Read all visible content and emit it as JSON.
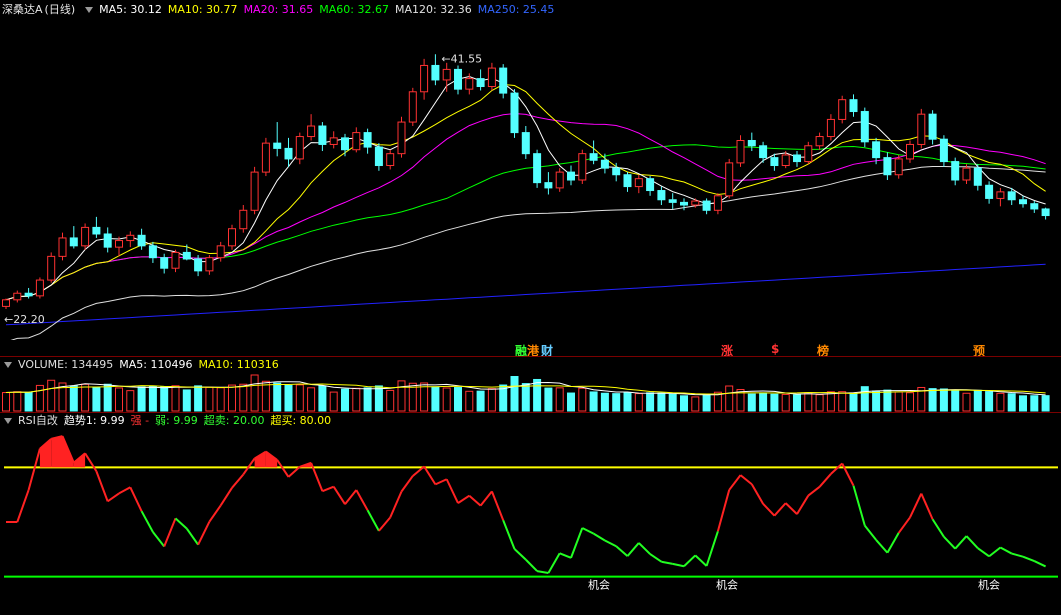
{
  "price_header": {
    "stock_name": "深桑达A",
    "period": "(日线)",
    "ma5": "MA5: 30.12",
    "ma10": "MA10: 30.77",
    "ma20": "MA20: 31.65",
    "ma60": "MA60: 32.67",
    "ma120": "MA120: 32.36",
    "ma250": "MA250: 25.45"
  },
  "price_labels": {
    "high": "41.55",
    "low": "22.20"
  },
  "events": [
    {
      "id": "e1",
      "text": "融",
      "color": "#33ff33"
    },
    {
      "id": "e2",
      "text": "港",
      "color": "#ff8800"
    },
    {
      "id": "e3",
      "text": "财",
      "color": "#66ccff"
    },
    {
      "id": "e4",
      "text": "涨",
      "color": "#ff3333"
    },
    {
      "id": "e5",
      "text": "$",
      "color": "#ff3333"
    },
    {
      "id": "e6",
      "text": "榜",
      "color": "#ff8800"
    },
    {
      "id": "e7",
      "text": "预",
      "color": "#ff8800"
    }
  ],
  "volume_header": {
    "name": "VOLUME: 134495",
    "ma5": "MA5: 110496",
    "ma10": "MA10: 110316"
  },
  "rsi_header": {
    "name": "RSI自改",
    "trend": "趋势1: 9.99",
    "strong": "强 -",
    "weak": "弱: 9.99",
    "oversold": "超卖: 20.00",
    "overbought": "超买: 80.00"
  },
  "rsi_labels": [
    "机会",
    "机会",
    "机会"
  ],
  "colors": {
    "up": "#ff3232",
    "down": "#54ffff",
    "ma5": "#ffffff",
    "ma10": "#ffff00",
    "ma20": "#ff00ff",
    "ma60": "#00ff00",
    "ma120": "#e0e0e0",
    "ma250": "#2222ff",
    "grid": "#7a0000"
  },
  "chart_data": {
    "type": "candlestick",
    "ylim": [
      20,
      44
    ],
    "candles": [
      [
        22.4,
        23.0,
        22.2,
        22.9
      ],
      [
        22.9,
        23.6,
        22.7,
        23.4
      ],
      [
        23.4,
        23.8,
        23.0,
        23.2
      ],
      [
        23.2,
        24.6,
        23.0,
        24.4
      ],
      [
        24.4,
        26.5,
        24.2,
        26.2
      ],
      [
        26.2,
        28.0,
        25.9,
        27.6
      ],
      [
        27.6,
        28.5,
        26.8,
        27.0
      ],
      [
        27.0,
        28.7,
        26.7,
        28.4
      ],
      [
        28.4,
        29.2,
        27.6,
        27.9
      ],
      [
        27.9,
        28.4,
        26.5,
        26.9
      ],
      [
        26.9,
        27.7,
        26.2,
        27.4
      ],
      [
        27.4,
        28.1,
        26.9,
        27.8
      ],
      [
        27.8,
        28.3,
        26.7,
        27.0
      ],
      [
        27.0,
        27.3,
        25.7,
        26.1
      ],
      [
        26.1,
        26.4,
        24.9,
        25.3
      ],
      [
        25.3,
        26.7,
        25.0,
        26.5
      ],
      [
        26.5,
        27.1,
        25.9,
        26.0
      ],
      [
        26.0,
        26.3,
        24.7,
        25.1
      ],
      [
        25.1,
        26.3,
        24.8,
        26.1
      ],
      [
        26.1,
        27.3,
        25.8,
        27.0
      ],
      [
        27.0,
        28.6,
        26.7,
        28.3
      ],
      [
        28.3,
        30.1,
        28.0,
        29.7
      ],
      [
        29.7,
        33.0,
        29.4,
        32.6
      ],
      [
        32.6,
        35.2,
        32.3,
        34.8
      ],
      [
        34.8,
        36.4,
        33.8,
        34.4
      ],
      [
        34.4,
        35.2,
        33.0,
        33.6
      ],
      [
        33.6,
        35.6,
        33.2,
        35.3
      ],
      [
        35.3,
        37.0,
        35.0,
        36.1
      ],
      [
        36.1,
        36.4,
        34.2,
        34.7
      ],
      [
        34.7,
        35.7,
        34.4,
        35.2
      ],
      [
        35.2,
        35.5,
        33.8,
        34.3
      ],
      [
        34.3,
        36.0,
        34.1,
        35.6
      ],
      [
        35.6,
        35.9,
        34.0,
        34.5
      ],
      [
        34.5,
        34.8,
        32.7,
        33.1
      ],
      [
        33.1,
        34.3,
        32.8,
        34.0
      ],
      [
        34.0,
        36.8,
        33.7,
        36.4
      ],
      [
        36.4,
        39.0,
        36.1,
        38.7
      ],
      [
        38.7,
        41.2,
        38.1,
        40.7
      ],
      [
        40.7,
        41.55,
        39.2,
        39.6
      ],
      [
        39.6,
        40.9,
        38.7,
        40.4
      ],
      [
        40.4,
        40.7,
        38.5,
        38.9
      ],
      [
        38.9,
        40.1,
        38.5,
        39.7
      ],
      [
        39.7,
        40.4,
        38.8,
        39.1
      ],
      [
        39.1,
        40.9,
        38.8,
        40.5
      ],
      [
        40.5,
        40.8,
        38.2,
        38.6
      ],
      [
        38.6,
        38.9,
        35.2,
        35.6
      ],
      [
        35.6,
        36.1,
        33.6,
        34.0
      ],
      [
        34.0,
        34.3,
        31.4,
        31.8
      ],
      [
        31.8,
        32.6,
        30.9,
        31.4
      ],
      [
        31.4,
        32.9,
        31.1,
        32.6
      ],
      [
        32.6,
        33.1,
        31.6,
        32.0
      ],
      [
        32.0,
        34.3,
        31.7,
        34.0
      ],
      [
        34.0,
        35.0,
        33.2,
        33.5
      ],
      [
        33.5,
        34.0,
        32.5,
        32.9
      ],
      [
        32.9,
        33.3,
        31.9,
        32.4
      ],
      [
        32.4,
        32.6,
        31.1,
        31.5
      ],
      [
        31.5,
        32.4,
        31.0,
        32.1
      ],
      [
        32.1,
        32.3,
        30.8,
        31.2
      ],
      [
        31.2,
        31.5,
        30.1,
        30.5
      ],
      [
        30.5,
        31.0,
        29.8,
        30.3
      ],
      [
        30.3,
        30.6,
        29.7,
        30.1
      ],
      [
        30.1,
        30.6,
        29.9,
        30.4
      ],
      [
        30.4,
        30.6,
        29.4,
        29.7
      ],
      [
        29.7,
        31.0,
        29.4,
        30.8
      ],
      [
        30.8,
        33.6,
        30.6,
        33.3
      ],
      [
        33.3,
        35.4,
        33.0,
        35.0
      ],
      [
        35.0,
        35.6,
        34.2,
        34.6
      ],
      [
        34.6,
        34.9,
        33.3,
        33.7
      ],
      [
        33.7,
        34.0,
        32.7,
        33.1
      ],
      [
        33.1,
        34.2,
        32.9,
        33.9
      ],
      [
        33.9,
        34.2,
        33.0,
        33.4
      ],
      [
        33.4,
        34.9,
        33.2,
        34.6
      ],
      [
        34.6,
        35.6,
        34.3,
        35.3
      ],
      [
        35.3,
        37.0,
        35.0,
        36.6
      ],
      [
        36.6,
        38.4,
        36.3,
        38.1
      ],
      [
        38.1,
        38.5,
        36.8,
        37.2
      ],
      [
        37.2,
        37.5,
        34.5,
        34.9
      ],
      [
        34.9,
        35.2,
        33.2,
        33.7
      ],
      [
        33.7,
        34.1,
        32.0,
        32.4
      ],
      [
        32.4,
        33.9,
        32.1,
        33.6
      ],
      [
        33.6,
        35.0,
        33.3,
        34.7
      ],
      [
        34.7,
        37.4,
        34.4,
        37.0
      ],
      [
        37.0,
        37.3,
        34.7,
        35.1
      ],
      [
        35.1,
        35.4,
        33.0,
        33.4
      ],
      [
        33.4,
        33.7,
        31.6,
        32.0
      ],
      [
        32.0,
        33.2,
        31.7,
        32.9
      ],
      [
        32.9,
        33.2,
        31.2,
        31.6
      ],
      [
        31.6,
        31.9,
        30.2,
        30.6
      ],
      [
        30.6,
        31.4,
        30.0,
        31.1
      ],
      [
        31.1,
        31.4,
        30.1,
        30.5
      ],
      [
        30.5,
        30.8,
        29.9,
        30.2
      ],
      [
        30.2,
        30.4,
        29.5,
        29.8
      ],
      [
        29.8,
        29.9,
        29.0,
        29.3
      ]
    ],
    "volume_ylim": [
      0,
      200000
    ],
    "rsi_ylim": [
      0,
      100
    ],
    "rsi_levels": {
      "overbought": 80,
      "oversold": 20
    }
  }
}
